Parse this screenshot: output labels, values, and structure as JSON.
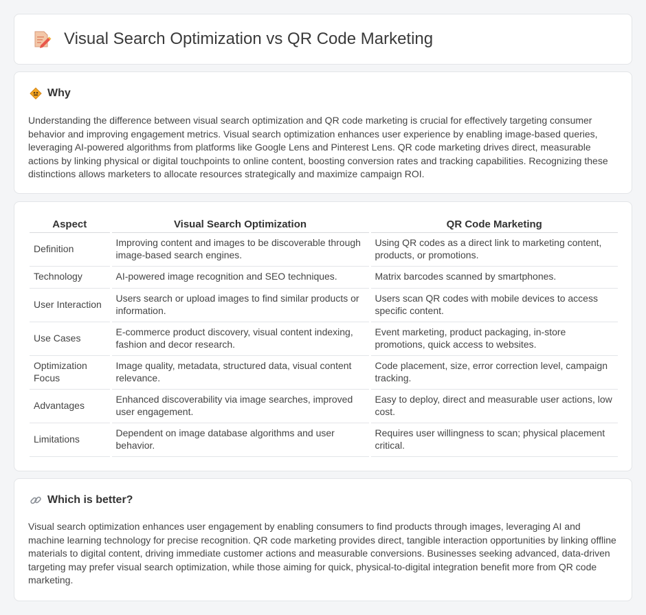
{
  "header": {
    "title": "Visual Search Optimization vs QR Code Marketing",
    "icon": "document-pencil-icon"
  },
  "why": {
    "title": "Why",
    "icon": "diamond-sign-icon",
    "text": "Understanding the difference between visual search optimization and QR code marketing is crucial for effectively targeting consumer behavior and improving engagement metrics. Visual search optimization enhances user experience by enabling image-based queries, leveraging AI-powered algorithms from platforms like Google Lens and Pinterest Lens. QR code marketing drives direct, measurable actions by linking physical or digital touchpoints to online content, boosting conversion rates and tracking capabilities. Recognizing these distinctions allows marketers to allocate resources strategically and maximize campaign ROI."
  },
  "table": {
    "headers": [
      "Aspect",
      "Visual Search Optimization",
      "QR Code Marketing"
    ],
    "rows": [
      {
        "aspect": "Definition",
        "vso": "Improving content and images to be discoverable through image-based search engines.",
        "qr": "Using QR codes as a direct link to marketing content, products, or promotions."
      },
      {
        "aspect": "Technology",
        "vso": "AI-powered image recognition and SEO techniques.",
        "qr": "Matrix barcodes scanned by smartphones."
      },
      {
        "aspect": "User Interaction",
        "vso": "Users search or upload images to find similar products or information.",
        "qr": "Users scan QR codes with mobile devices to access specific content."
      },
      {
        "aspect": "Use Cases",
        "vso": "E-commerce product discovery, visual content indexing, fashion and decor research.",
        "qr": "Event marketing, product packaging, in-store promotions, quick access to websites."
      },
      {
        "aspect": "Optimization Focus",
        "vso": "Image quality, metadata, structured data, visual content relevance.",
        "qr": "Code placement, size, error correction level, campaign tracking."
      },
      {
        "aspect": "Advantages",
        "vso": "Enhanced discoverability via image searches, improved user engagement.",
        "qr": "Easy to deploy, direct and measurable user actions, low cost."
      },
      {
        "aspect": "Limitations",
        "vso": "Dependent on image database algorithms and user behavior.",
        "qr": "Requires user willingness to scan; physical placement critical."
      }
    ]
  },
  "better": {
    "title": "Which is better?",
    "icon": "link-icon",
    "text": "Visual search optimization enhances user engagement by enabling consumers to find products through images, leveraging AI and machine learning technology for precise recognition. QR code marketing provides direct, tangible interaction opportunities by linking offline materials to digital content, driving immediate customer actions and measurable conversions. Businesses seeking advanced, data-driven targeting may prefer visual search optimization, while those aiming for quick, physical-to-digital integration benefit more from QR code marketing."
  }
}
